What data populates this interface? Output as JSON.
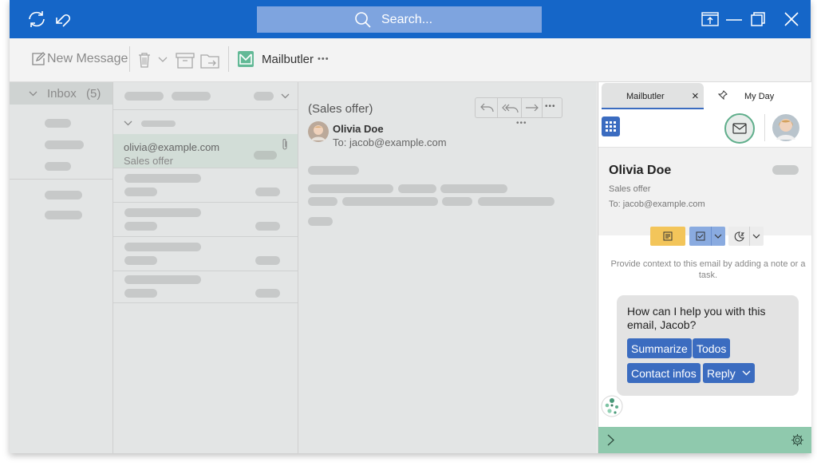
{
  "titlebar": {
    "search_placeholder": "Search..."
  },
  "toolbar": {
    "new_message": "New Message",
    "mailbutler": "Mailbutler",
    "more": "•••"
  },
  "folders": {
    "inbox_label": "Inbox",
    "inbox_count": "(5)"
  },
  "message_list": {
    "selected": {
      "from": "olivia@example.com",
      "subject": "Sales offer"
    }
  },
  "reading": {
    "subject": "(Sales offer)",
    "sender": "Olivia Doe",
    "to": "To: jacob@example.com",
    "more": "•••"
  },
  "panel": {
    "tabs": [
      {
        "label": "Mailbutler",
        "close": "×"
      },
      {
        "label": "My Day"
      }
    ],
    "contact": {
      "name": "Olivia Doe",
      "subject": "Sales offer",
      "to": "To: jacob@example.com"
    },
    "hint": "Provide context to this email by adding a note or a task.",
    "assistant": {
      "question": "How can I help you with this email, Jacob?",
      "buttons": {
        "summarize": "Summarize",
        "todos": "Todos",
        "contact_infos": "Contact infos",
        "reply": "Reply"
      }
    }
  },
  "colors": {
    "titlebar": "#1566c8",
    "accent_blue": "#3b6cc0",
    "mailbutler_green": "#8fc9ad",
    "note_yellow": "#f3c55a"
  }
}
